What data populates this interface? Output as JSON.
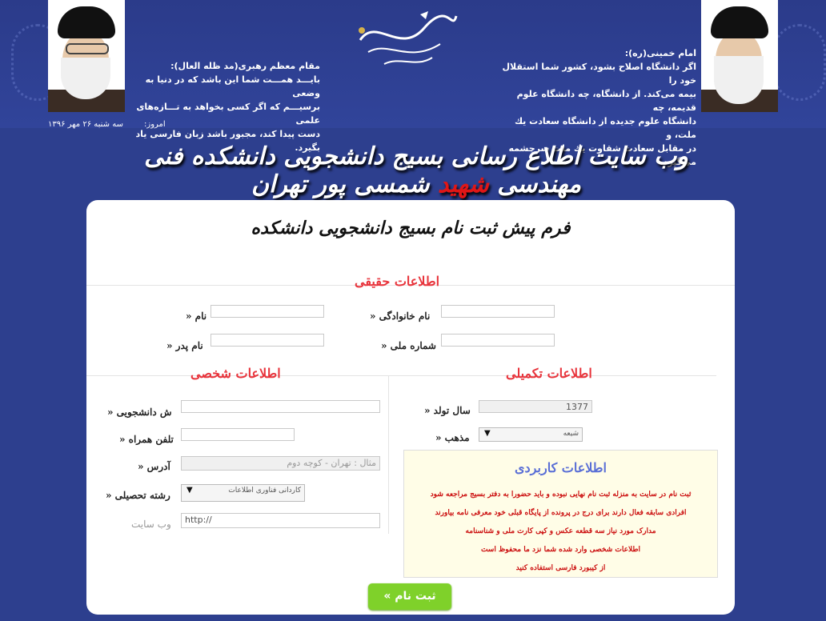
{
  "header": {
    "left_quote": {
      "title": "مقام معظم رهبری(مد ظله العال):",
      "lines": [
        "بایـــد همـــت شما این باشد که در دنیا به وضعی",
        "برسیـــم که اگر کسی بخواهد به تـــازه‌های علمی",
        "دست پیدا کند، مجبور باشد زبان فارسی یاد بگیرد."
      ]
    },
    "right_quote": {
      "title": "امام خمینی(ره):",
      "lines": [
        "اگر دانشگاه اصلاح بشود، کشور شما استقلال خود را",
        "بیمه می‌کند. از دانشگاه، چه دانشگاه علوم قدیمه، چه",
        "دانشگاه علوم جدیده از دانشگاه  سعادت یك ملت، و",
        "در مقابل سعادت شقاوت یك ملت سرچشمه می‌گیرد."
      ]
    },
    "today_label": "امروز:",
    "today_value": "سه شنبه ۲۶ مهر ۱۳۹۶",
    "site_title_part1": "وب سایت اطلاع رسانی بسیج دانشجویی دانشکده فنی مهندسی",
    "site_title_red": "شهید",
    "site_title_part2": "شمسی پور تهران"
  },
  "form": {
    "title": "فرم پیش ثبت نام بسیج دانشجویی دانشکده",
    "sections": {
      "real_info": "اطلاعات حقیقی",
      "extra_info": "اطلاعات تکمیلی",
      "personal_info": "اطلاعات شخصی"
    },
    "fields": {
      "first_name_label": "نام «",
      "last_name_label": "نام خانوادگی «",
      "father_name_label": "نام پدر «",
      "national_id_label": "شماره ملی «",
      "student_id_label": "ش دانشجویی «",
      "mobile_label": "تلفن همراه «",
      "address_label": "آدرس «",
      "address_placeholder": "مثال : تهران - کوچه دوم",
      "major_label": "رشته تحصیلی «",
      "major_value": "کاردانی فناوری اطلاعات",
      "website_label": "وب سایت",
      "website_value": "http://",
      "birth_year_label": "سال تولد «",
      "birth_year_value": "1377",
      "religion_label": "مذهب «",
      "religion_value": "شیعه"
    },
    "info_box": {
      "title": "اطلاعات کاربردی",
      "lines": [
        "ثبت نام در سایت به منزله ثبت نام نهایی نبوده و باید حضورا به دفتر بسیج مراجعه شود",
        "افرادی سابقه فعال دارند برای درج در پرونده از پایگاه قبلی خود معرفی نامه بیاورند",
        "مدارک مورد نیاز سه قطعه عکس و کپی کارت ملی و شناسنامه",
        "اطلاعات شخصی وارد شده شما نزد ما محفوظ است",
        "از کیبورد فارسی استفاده کنید"
      ]
    },
    "submit_label": "ثبت نام »"
  },
  "colors": {
    "background": "#2d3f8e",
    "section_title": "#e8343c",
    "info_text": "#cc1010",
    "info_title": "#5a6fd6",
    "submit": "#7fd12a"
  }
}
